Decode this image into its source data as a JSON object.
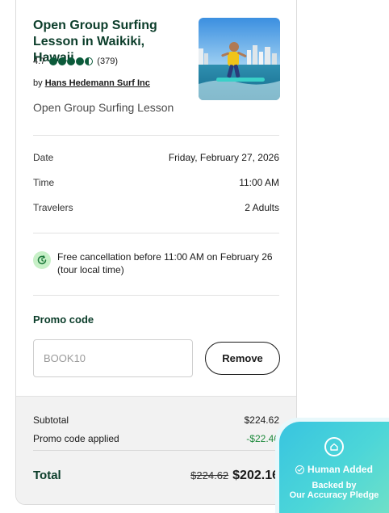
{
  "product": {
    "title": "Open Group Surfing Lesson in Waikiki, Hawaii",
    "rating": "4.7",
    "rating_value": 4.5,
    "review_count": "(379)",
    "by_prefix": "by",
    "operator": "Hans Hedemann Surf Inc",
    "option": "Open Group Surfing Lesson"
  },
  "details": {
    "date_label": "Date",
    "date_value": "Friday, February 27, 2026",
    "time_label": "Time",
    "time_value": "11:00 AM",
    "travelers_label": "Travelers",
    "travelers_value": "2 Adults"
  },
  "cancellation": {
    "text": "Free cancellation before 11:00 AM on February 26 (tour local time)",
    "icon": "refresh-clock-icon"
  },
  "promo": {
    "label": "Promo code",
    "value": "BOOK10",
    "remove_label": "Remove"
  },
  "summary": {
    "subtotal_label": "Subtotal",
    "subtotal_value": "$224.62",
    "promo_label": "Promo code applied",
    "promo_value": "-$22.46",
    "total_label": "Total",
    "total_original": "$224.62",
    "total_final": "$202.16"
  },
  "badge": {
    "title": "Human Added",
    "line1": "Backed by",
    "line2": "Our Accuracy Pledge"
  },
  "colors": {
    "brand_dark_green": "#0b3d2a",
    "rating_green": "#0b5a3a",
    "discount_green": "#1e8a3c",
    "badge_cyan": "#38c4e0"
  }
}
